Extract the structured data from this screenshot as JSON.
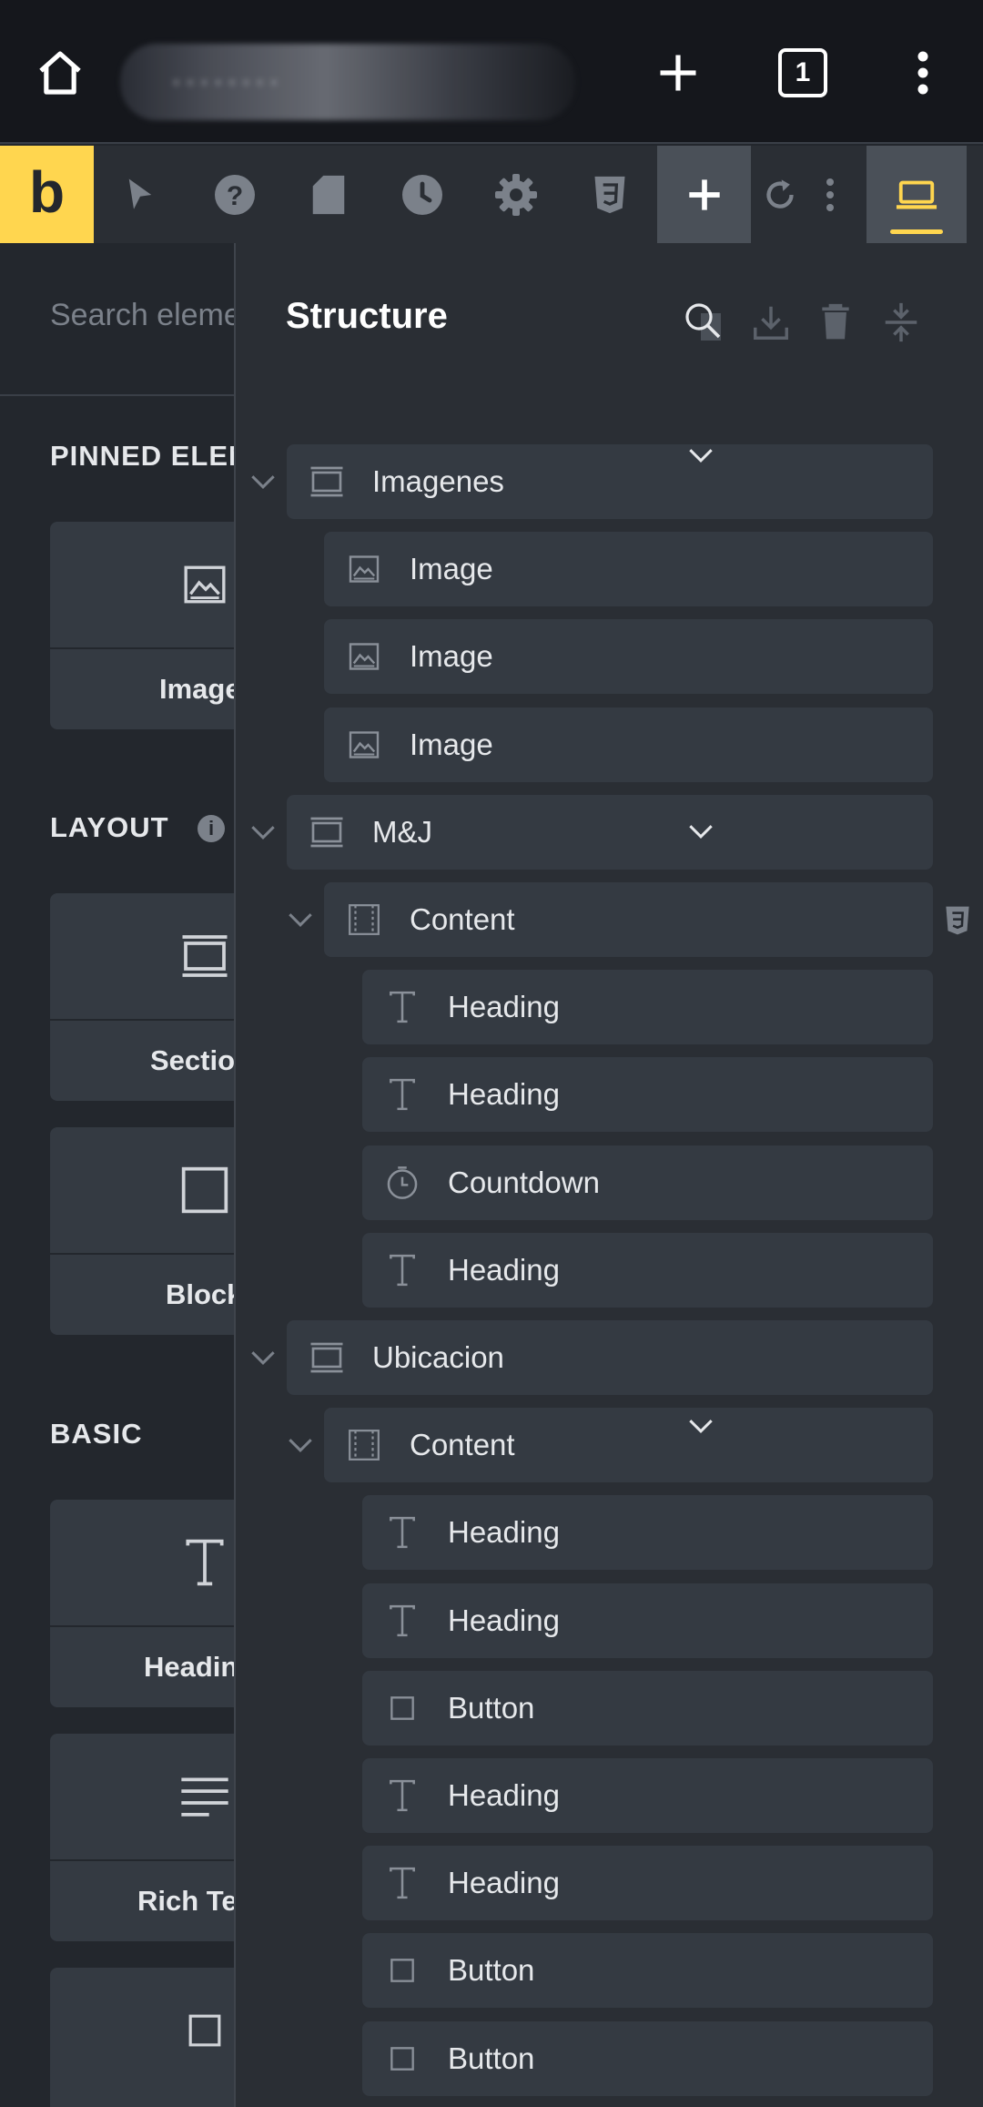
{
  "browser": {
    "url_display": "········",
    "tab_count": "1"
  },
  "toolbar": {
    "logo": "b",
    "icons": [
      "cursor-icon",
      "help-icon",
      "page-icon",
      "history-icon",
      "settings-icon",
      "css3-icon",
      "add-icon",
      "undo-icon",
      "more-icon",
      "desktop-icon"
    ]
  },
  "left_panel": {
    "search_placeholder": "Search elements",
    "categories": [
      {
        "title": "PINNED ELEMENTS",
        "elements": [
          {
            "label": "Image",
            "icon": "image-icon"
          }
        ]
      },
      {
        "title": "LAYOUT",
        "elements": [
          {
            "label": "Section",
            "icon": "section-icon"
          },
          {
            "label": "Block",
            "icon": "block-icon"
          }
        ]
      },
      {
        "title": "BASIC",
        "elements": [
          {
            "label": "Heading",
            "icon": "heading-icon"
          },
          {
            "label": "Rich Text",
            "icon": "rich-text-icon"
          },
          {
            "label": "",
            "icon": "button-icon"
          }
        ]
      }
    ]
  },
  "structure": {
    "title": "Structure",
    "rows": [
      {
        "label": "Imagenes",
        "icon": "section-icon",
        "level": 0,
        "expanded": true,
        "caret": true
      },
      {
        "label": "Image",
        "icon": "image-icon",
        "level": 1
      },
      {
        "label": "Image",
        "icon": "image-icon",
        "level": 1
      },
      {
        "label": "Image",
        "icon": "image-icon",
        "level": 1
      },
      {
        "label": "M&J",
        "icon": "section-icon",
        "level": 0,
        "expanded": true,
        "caret": true
      },
      {
        "label": "Content",
        "icon": "container-icon",
        "level": 1,
        "expanded": true
      },
      {
        "label": "Heading",
        "icon": "heading-icon",
        "level": 2
      },
      {
        "label": "Heading",
        "icon": "heading-icon",
        "level": 2
      },
      {
        "label": "Countdown",
        "icon": "countdown-icon",
        "level": 2
      },
      {
        "label": "Heading",
        "icon": "heading-icon",
        "level": 2
      },
      {
        "label": "Ubicacion",
        "icon": "section-icon",
        "level": 0,
        "expanded": true
      },
      {
        "label": "Content",
        "icon": "container-icon",
        "level": 1,
        "expanded": true,
        "caret": true
      },
      {
        "label": "Heading",
        "icon": "heading-icon",
        "level": 2
      },
      {
        "label": "Heading",
        "icon": "heading-icon",
        "level": 2
      },
      {
        "label": "Button",
        "icon": "button-icon",
        "level": 2
      },
      {
        "label": "Heading",
        "icon": "heading-icon",
        "level": 2
      },
      {
        "label": "Heading",
        "icon": "heading-icon",
        "level": 2
      },
      {
        "label": "Button",
        "icon": "button-icon",
        "level": 2
      },
      {
        "label": "Button",
        "icon": "button-icon",
        "level": 2
      }
    ]
  },
  "colors": {
    "accent": "#ffd64f",
    "panel": "#2a2e34",
    "row": "#343a42"
  }
}
